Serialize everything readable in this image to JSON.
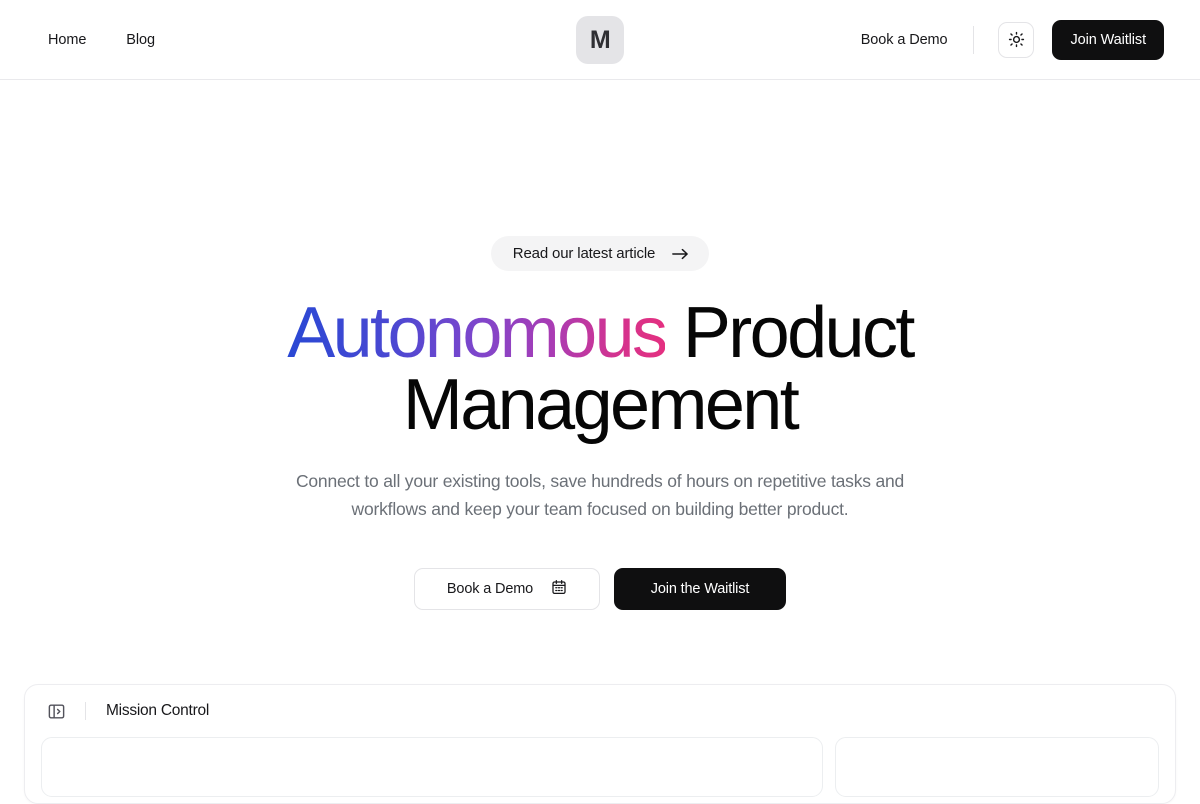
{
  "header": {
    "nav_links": [
      {
        "label": "Home",
        "name": "nav-link-home"
      },
      {
        "label": "Blog",
        "name": "nav-link-blog"
      }
    ],
    "logo_letter": "M",
    "book_demo_label": "Book a Demo",
    "theme_icon": "sun-icon",
    "join_waitlist_label": "Join Waitlist"
  },
  "hero": {
    "badge": {
      "label": "Read our latest article",
      "arrow_icon": "arrow-right-icon"
    },
    "headline": {
      "gradient_word": "Autonomous",
      "rest_line1": " Product",
      "line2": "Management",
      "gradient_start_color": "#2948d4",
      "gradient_end_color": "#e43080"
    },
    "subheading": "Connect to all your existing tools, save hundreds of hours on repetitive tasks and workflows and keep your team focused on building better product.",
    "primary_cta": {
      "label": "Book a Demo",
      "icon": "calendar-icon"
    },
    "secondary_cta": {
      "label": "Join the Waitlist"
    }
  },
  "mission_control": {
    "toggle_icon": "panel-expand-icon",
    "title": "Mission Control"
  }
}
